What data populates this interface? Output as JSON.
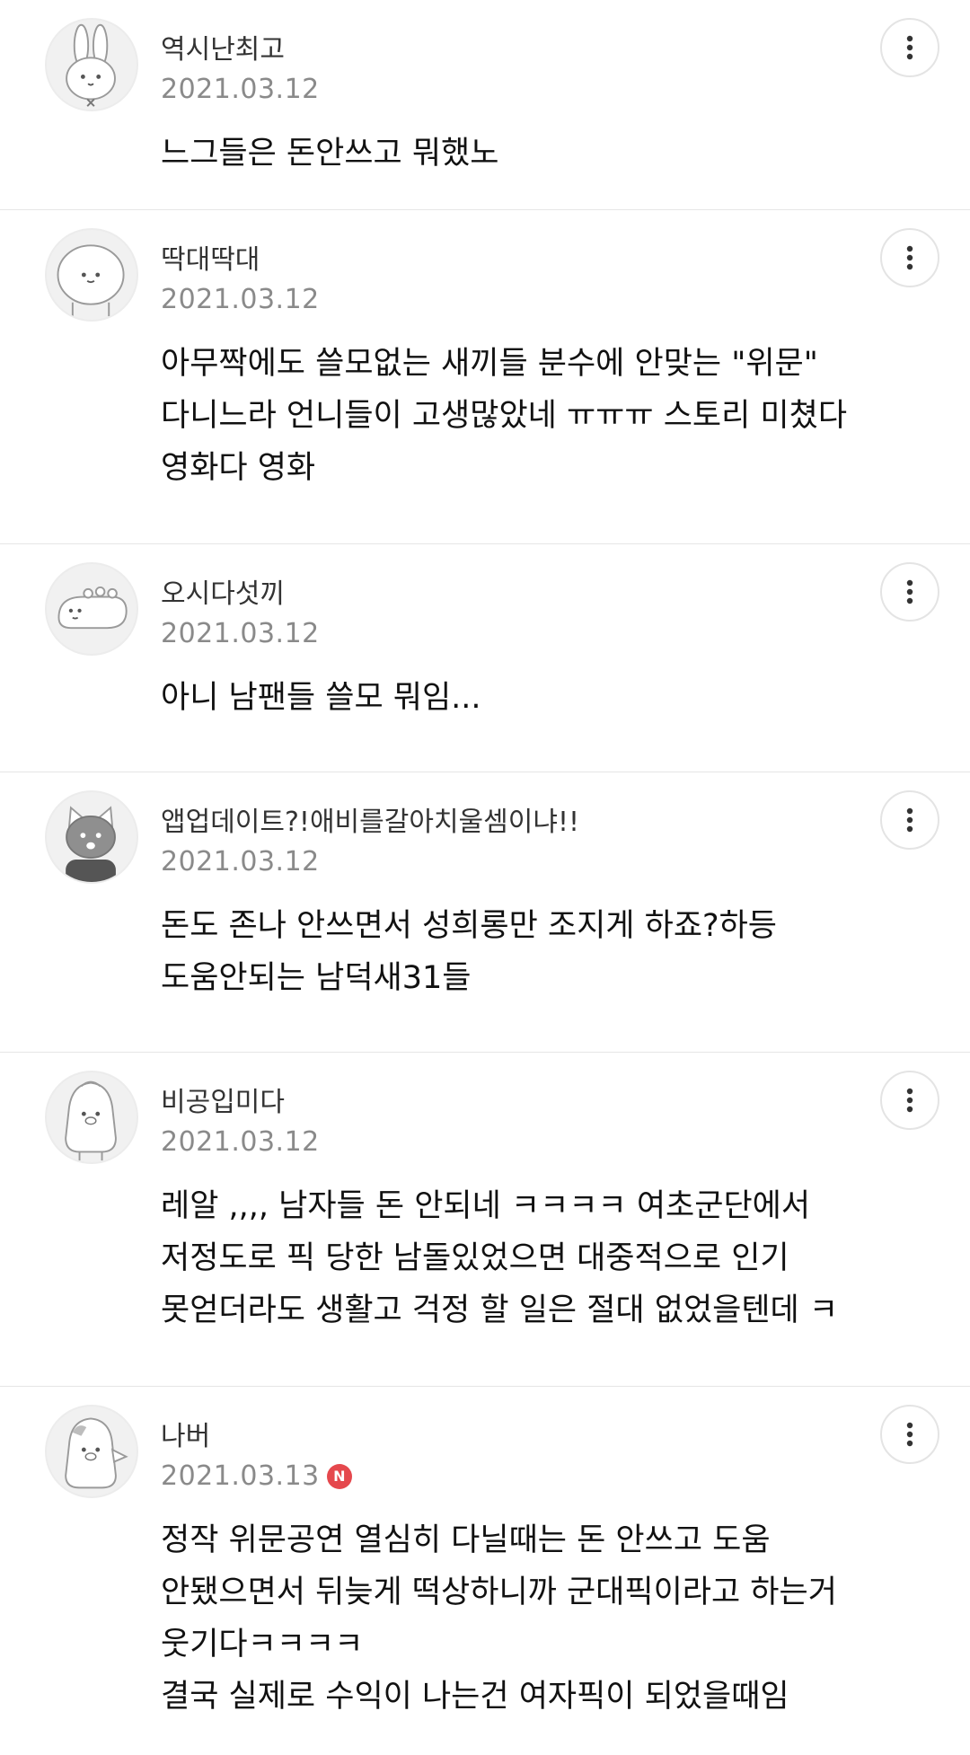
{
  "comments": [
    {
      "nickname": "역시난최고",
      "date": "2021.03.12",
      "avatar_icon": "bunny-avatar-icon",
      "lines": [
        "느그들은 돈안쓰고 뭐했노"
      ]
    },
    {
      "nickname": "딱대딱대",
      "date": "2021.03.12",
      "avatar_icon": "blob-avatar-icon",
      "lines": [
        "아무짝에도 쓸모없는 새끼들 분수에 안맞는 \"위문\"",
        "다니느라 언니들이 고생많았네 ㅠㅠㅠ 스토리 미쳤다",
        "영화다 영화"
      ]
    },
    {
      "nickname": "오시다섯끼",
      "date": "2021.03.12",
      "avatar_icon": "lying-creature-avatar-icon",
      "lines": [
        "아니 남팬들 쓸모 뭐임..."
      ]
    },
    {
      "nickname": "앱업데이트?!애비를갈아치울셈이냐!!",
      "date": "2021.03.12",
      "avatar_icon": "cat-avatar-icon",
      "lines": [
        "돈도 존나 안쓰면서 성희롱만 조지게 하죠?하등",
        "도움안되는 남덕새31들"
      ]
    },
    {
      "nickname": "비공입미다",
      "date": "2021.03.12",
      "avatar_icon": "penguin-avatar-icon",
      "lines": [
        "레알 ,,,, 남자들 돈 안되네 ㅋㅋㅋㅋ 여초군단에서",
        "저정도로 픽 당한 남돌있었으면 대중적으로 인기",
        "못얻더라도 생활고 걱정 할 일은 절대 없었을텐데 ㅋ"
      ]
    },
    {
      "nickname": "나버",
      "date": "2021.03.13",
      "badge": "N",
      "avatar_icon": "ghost-penguin-avatar-icon",
      "lines": [
        "정작 위문공연 열심히 다닐때는 돈 안쓰고 도움",
        "안됐으면서 뒤늦게 떡상하니까 군대픽이라고 하는거",
        "웃기다ㅋㅋㅋㅋ",
        "결국 실제로 수익이 나는건 여자픽이 되었을때임"
      ]
    }
  ],
  "icons": {
    "more": "more-vertical-icon"
  },
  "colors": {
    "badge": "#e5484d",
    "date": "#8a8a8a",
    "divider": "#e6e6e6"
  }
}
